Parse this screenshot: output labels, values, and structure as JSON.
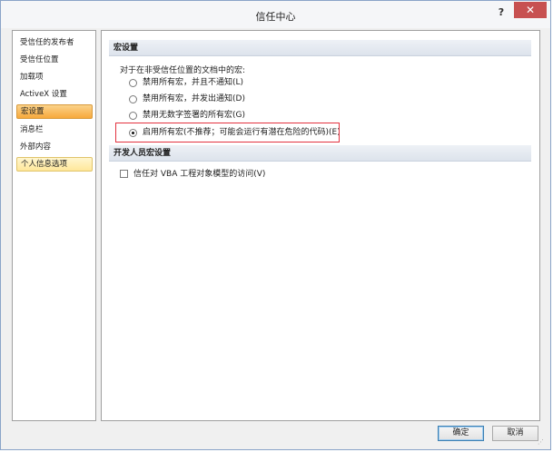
{
  "window": {
    "title": "信任中心",
    "help_label": "?",
    "close_label": "✕"
  },
  "sidebar": {
    "items": [
      {
        "label": "受信任的发布者"
      },
      {
        "label": "受信任位置"
      },
      {
        "label": "加载项"
      },
      {
        "label": "ActiveX 设置"
      },
      {
        "label": "宏设置",
        "state": "selected"
      },
      {
        "label": "消息栏"
      },
      {
        "label": "外部内容"
      },
      {
        "label": "个人信息选项",
        "state": "hover"
      }
    ]
  },
  "macro_settings": {
    "header": "宏设置",
    "prompt": "对于在非受信任位置的文档中的宏:",
    "options": [
      {
        "label": "禁用所有宏，并且不通知(L)",
        "selected": false
      },
      {
        "label": "禁用所有宏，并发出通知(D)",
        "selected": false
      },
      {
        "label": "禁用无数字签署的所有宏(G)",
        "selected": false
      },
      {
        "label": "启用所有宏(不推荐；可能会运行有潜在危险的代码)(E)",
        "selected": true
      }
    ]
  },
  "developer_settings": {
    "header": "开发人员宏设置",
    "vba_access_label": "信任对 VBA 工程对象模型的访问(V)",
    "vba_access_checked": false
  },
  "footer": {
    "ok_label": "确定",
    "cancel_label": "取消"
  },
  "colors": {
    "selected_item": "#f7a83c",
    "hover_item": "#ffe79a",
    "highlight_box": "#e3323f",
    "close_button": "#c75050"
  }
}
